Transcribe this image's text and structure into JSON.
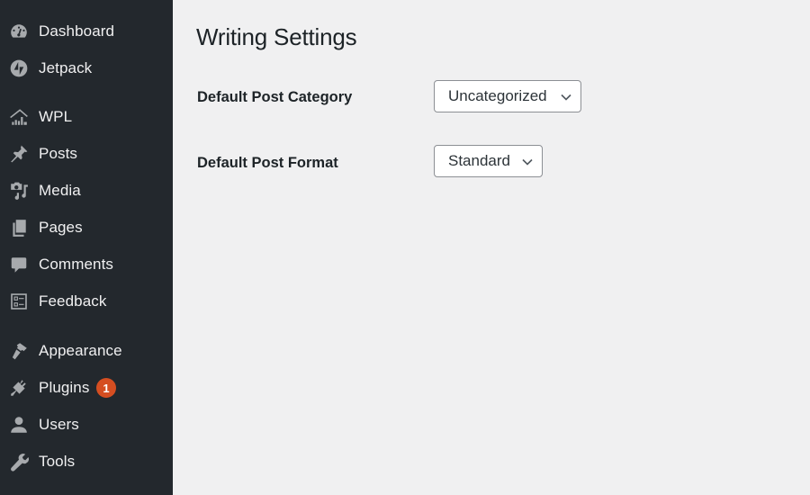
{
  "sidebar": {
    "items": [
      {
        "label": "Dashboard",
        "icon": "dashboard-icon"
      },
      {
        "label": "Jetpack",
        "icon": "jetpack-icon"
      },
      {
        "label": "WPL",
        "icon": "wpl-house-icon"
      },
      {
        "label": "Posts",
        "icon": "pushpin-icon"
      },
      {
        "label": "Media",
        "icon": "media-icon"
      },
      {
        "label": "Pages",
        "icon": "pages-icon"
      },
      {
        "label": "Comments",
        "icon": "comment-icon"
      },
      {
        "label": "Feedback",
        "icon": "feedback-form-icon"
      },
      {
        "label": "Appearance",
        "icon": "paintbrush-icon"
      },
      {
        "label": "Plugins",
        "icon": "plug-icon",
        "badge": "1"
      },
      {
        "label": "Users",
        "icon": "user-icon"
      },
      {
        "label": "Tools",
        "icon": "wrench-icon"
      }
    ]
  },
  "main": {
    "title": "Writing Settings",
    "fields": [
      {
        "label": "Default Post Category",
        "value": "Uncategorized"
      },
      {
        "label": "Default Post Format",
        "value": "Standard"
      }
    ]
  },
  "colors": {
    "sidebar_bg": "#23282d",
    "page_bg": "#f0f0f1",
    "badge": "#d54e21",
    "icon": "#a7aaad"
  }
}
